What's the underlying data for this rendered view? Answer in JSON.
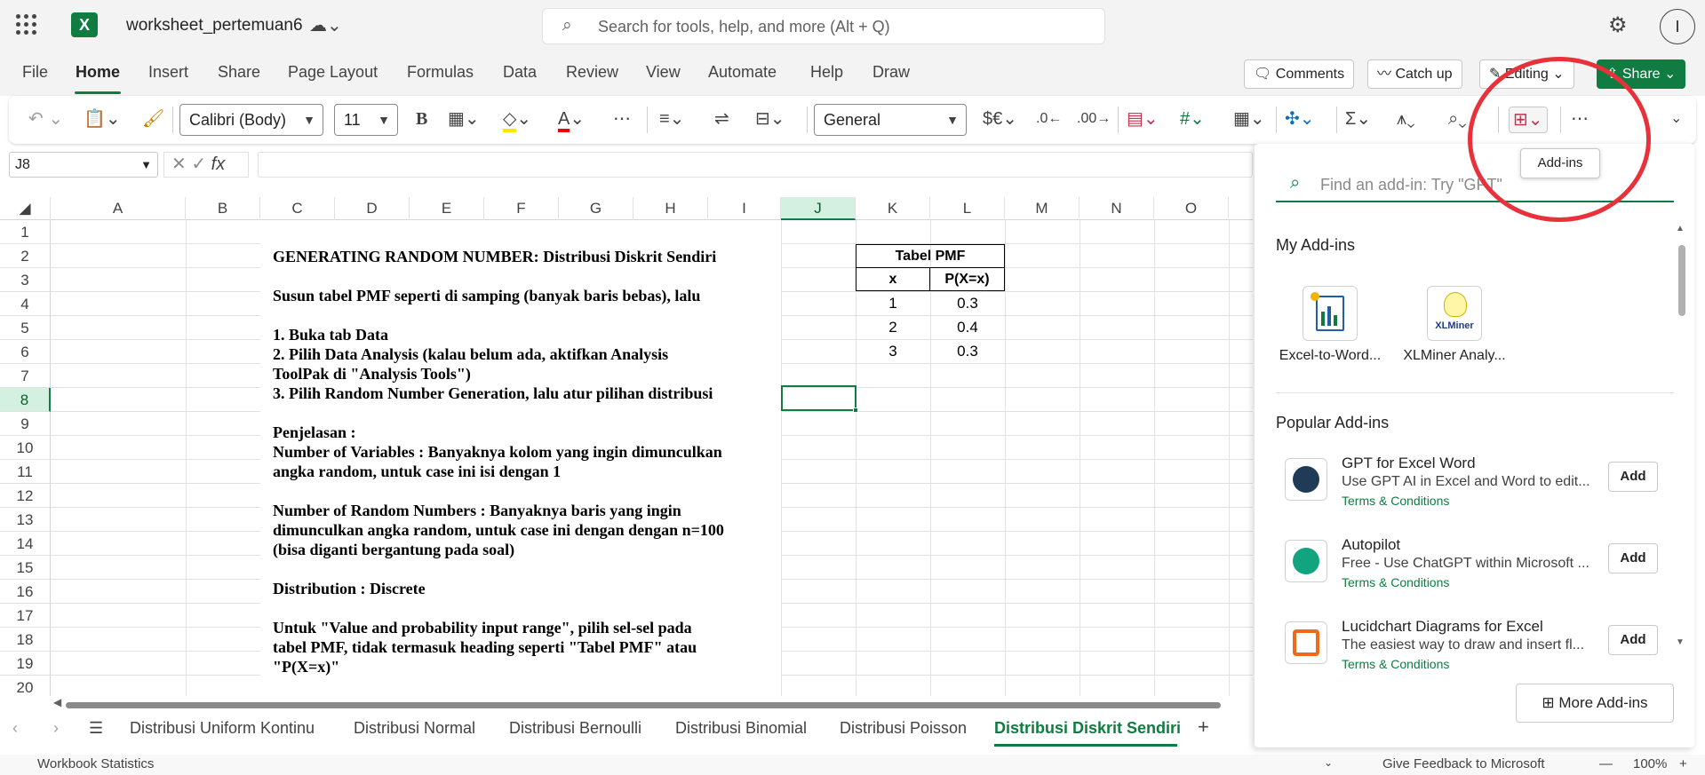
{
  "app": {
    "title": "worksheet_pertemuan6",
    "logo": "X"
  },
  "search": {
    "placeholder": "Search for tools, help, and more (Alt + Q)"
  },
  "user": {
    "initial": "I"
  },
  "menu": {
    "items": [
      "File",
      "Home",
      "Insert",
      "Share",
      "Page Layout",
      "Formulas",
      "Data",
      "Review",
      "View",
      "Automate",
      "Help",
      "Draw"
    ],
    "active": "Home"
  },
  "top_buttons": {
    "comments": "Comments",
    "catch_up": "Catch up",
    "editing": "Editing",
    "share": "Share"
  },
  "ribbon": {
    "font": "Calibri (Body)",
    "size": "11",
    "number_format": "General",
    "currency": "$€",
    "bold": "B"
  },
  "formula_bar": {
    "name_box": "J8",
    "fx": "fx"
  },
  "columns": [
    "A",
    "B",
    "C",
    "D",
    "E",
    "F",
    "G",
    "H",
    "I",
    "J",
    "K",
    "L",
    "M",
    "N",
    "O"
  ],
  "selected_column": "J",
  "rows": [
    "1",
    "2",
    "3",
    "4",
    "5",
    "6",
    "7",
    "8",
    "9",
    "10",
    "11",
    "12",
    "13",
    "14",
    "15",
    "16",
    "17",
    "18",
    "19",
    "20"
  ],
  "selected_row": "8",
  "text_block": {
    "lines": [
      "GENERATING RANDOM NUMBER: Distribusi Diskrit Sendiri",
      "Susun tabel PMF seperti di samping (banyak baris bebas), lalu",
      "1. Buka tab Data",
      "2. Pilih Data Analysis (kalau belum ada, aktifkan Analysis",
      "ToolPak di \"Analysis Tools\")",
      "3. Pilih Random Number Generation, lalu atur pilihan distribusi",
      "Penjelasan :",
      "Number of Variables : Banyaknya kolom yang ingin dimunculkan",
      "angka random, untuk case ini isi dengan 1",
      "Number of Random Numbers : Banyaknya baris yang ingin",
      "dimunculkan angka random, untuk case ini dengan dengan n=100",
      "(bisa diganti bergantung pada soal)",
      "Distribution : Discrete",
      "Untuk \"Value and probability input range\", pilih sel-sel pada",
      "tabel PMF, tidak termasuk heading seperti \"Tabel PMF\" atau",
      "\"P(X=x)\""
    ]
  },
  "pmf_table": {
    "title": "Tabel PMF",
    "headers": [
      "x",
      "P(X=x)"
    ],
    "rows": [
      [
        "1",
        "0.3"
      ],
      [
        "2",
        "0.4"
      ],
      [
        "3",
        "0.3"
      ]
    ]
  },
  "sheet_tabs": [
    "Distribusi Uniform Kontinu",
    "Distribusi Normal",
    "Distribusi Bernoulli",
    "Distribusi Binomial",
    "Distribusi Poisson",
    "Distribusi Diskrit Sendiri"
  ],
  "active_sheet": "Distribusi Diskrit Sendiri",
  "status": {
    "left": "Workbook Statistics",
    "feedback": "Give Feedback to Microsoft",
    "zoom": "100%"
  },
  "addins_panel": {
    "tooltip": "Add-ins",
    "search_placeholder": "Find an add-in: Try \"GPT\"",
    "my_title": "My Add-ins",
    "my_addins": [
      {
        "name": "Excel-to-Word..."
      },
      {
        "name": "XLMiner Analy...",
        "logo_text": "XLMiner"
      }
    ],
    "popular_title": "Popular Add-ins",
    "popular": [
      {
        "name": "GPT for Excel Word",
        "desc": "Use GPT AI in Excel and Word to edit...",
        "terms": "Terms & Conditions",
        "add": "Add",
        "color": "#1f3b57"
      },
      {
        "name": "Autopilot",
        "desc": "Free - Use ChatGPT within Microsoft ...",
        "terms": "Terms & Conditions",
        "add": "Add",
        "color": "#12a37f"
      },
      {
        "name": "Lucidchart Diagrams for Excel",
        "desc": "The easiest way to draw and insert fl...",
        "terms": "Terms & Conditions",
        "add": "Add",
        "color": "#f06a1c"
      }
    ],
    "more": "More Add-ins"
  },
  "colors": {
    "accent": "#107c41",
    "highlight": "#e8313a"
  }
}
